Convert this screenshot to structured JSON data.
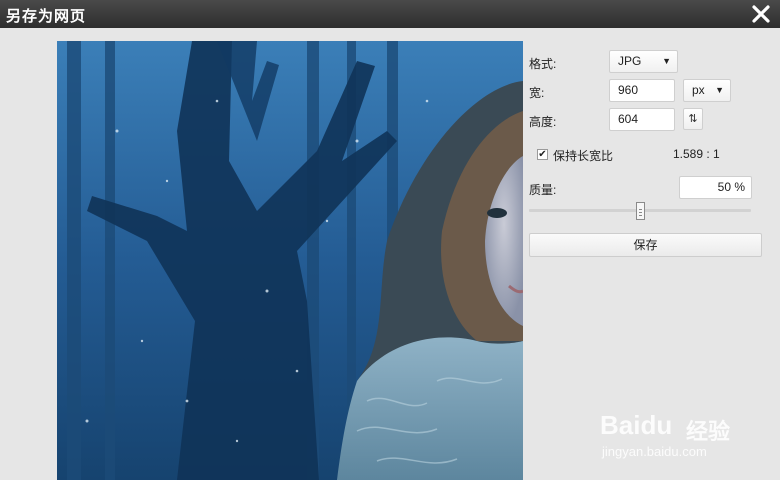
{
  "window": {
    "title": "另存为网页"
  },
  "panel": {
    "format_label": "格式:",
    "format_value": "JPG",
    "width_label": "宽:",
    "width_value": "960",
    "unit_value": "px",
    "height_label": "高度:",
    "height_value": "604",
    "keep_ratio_label": "保持长宽比",
    "keep_ratio_checked": true,
    "ratio_value": "1.589 : 1",
    "quality_label": "质量:",
    "quality_value": "50 %",
    "quality_fraction": 0.5,
    "save_label": "保存"
  },
  "watermark": {
    "brand": "Baidu",
    "brand_cn": "经验",
    "url": "jingyan.baidu.com"
  },
  "icons": {
    "close": "close-icon",
    "swap": "swap-arrows-icon",
    "check": "check-icon",
    "dropdown": "chevron-down-icon"
  },
  "colors": {
    "titlebar": "#3a3a3a",
    "panel_bg": "#e6e6e6",
    "preview_blue": "#1a4f85"
  }
}
